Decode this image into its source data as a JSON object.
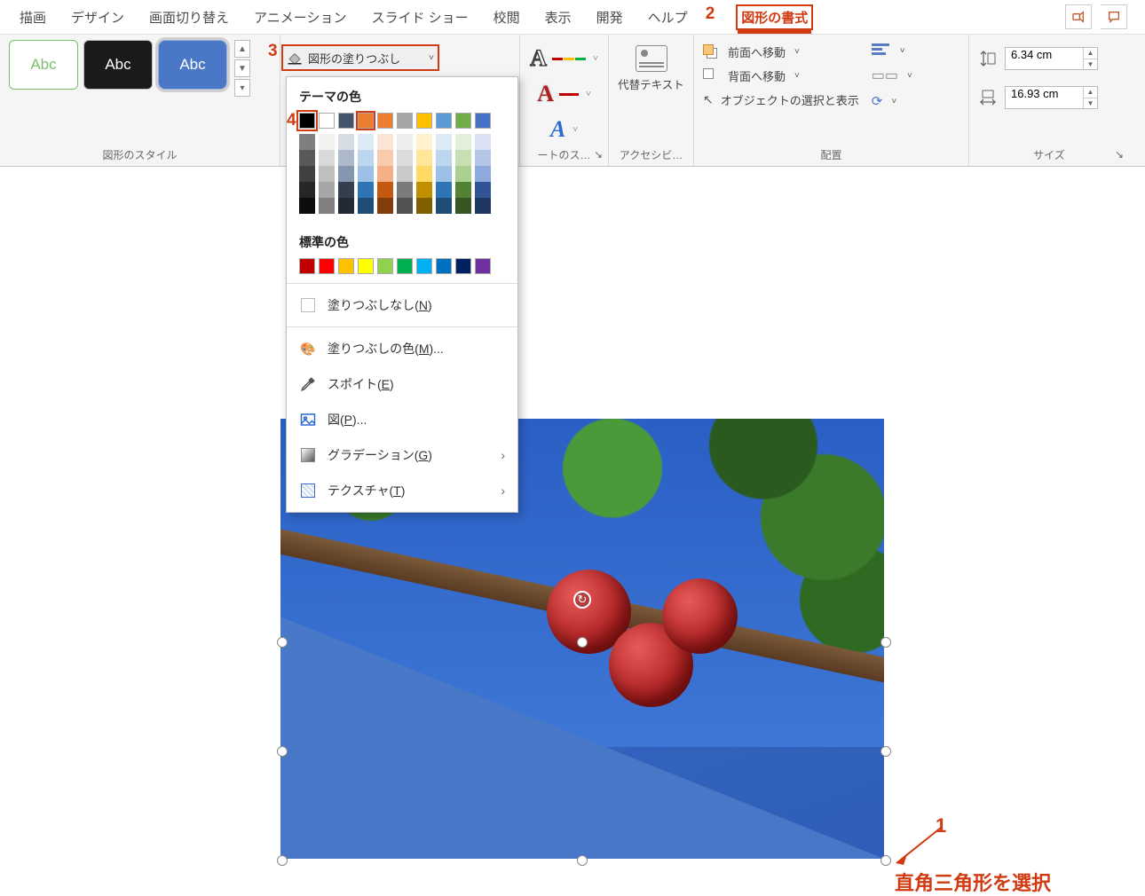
{
  "tabs": {
    "draw": "描画",
    "design": "デザイン",
    "transition": "画面切り替え",
    "animation": "アニメーション",
    "slideshow": "スライド ショー",
    "review": "校閲",
    "view": "表示",
    "developer": "開発",
    "help": "ヘルプ",
    "shape_format": "図形の書式"
  },
  "ribbon": {
    "style_group_label": "図形のスタイル",
    "abc": "Abc",
    "fill_button_label": "図形の塗りつぶし",
    "wordart_group_label": "ートのス…",
    "alt_text": "代替テキスト",
    "accessibility_label": "アクセシビ…",
    "arrange": {
      "bring_forward": "前面へ移動",
      "send_backward": "背面へ移動",
      "selection_pane": "オブジェクトの選択と表示",
      "group_label": "配置"
    },
    "size": {
      "height": "6.34 cm",
      "width": "16.93 cm",
      "group_label": "サイズ"
    }
  },
  "color_popup": {
    "theme_title": "テーマの色",
    "standard_title": "標準の色",
    "no_fill": "塗りつぶしなし",
    "no_fill_key": "N",
    "more_colors": "塗りつぶしの色",
    "more_colors_key": "M",
    "eyedropper": "スポイト",
    "eyedropper_key": "E",
    "picture": "図",
    "picture_key": "P",
    "gradient": "グラデーション",
    "gradient_key": "G",
    "texture": "テクスチャ",
    "texture_key": "T",
    "theme_row": [
      "#000000",
      "#ffffff",
      "#44546a",
      "#ed7d31",
      "#ed7d31",
      "#a5a5a5",
      "#ffc000",
      "#5b9bd5",
      "#70ad47",
      "#4472c4"
    ],
    "shade_cols": [
      [
        "#7f7f7f",
        "#595959",
        "#404040",
        "#262626",
        "#0d0d0d"
      ],
      [
        "#f2f2f2",
        "#d9d9d9",
        "#bfbfbf",
        "#a6a6a6",
        "#808080"
      ],
      [
        "#d5dce4",
        "#acb9ca",
        "#8496b0",
        "#333f4f",
        "#222b35"
      ],
      [
        "#deebf7",
        "#bdd7ee",
        "#9bc2e6",
        "#2f75b5",
        "#1f4e78"
      ],
      [
        "#fbe5d6",
        "#f8cbad",
        "#f4b084",
        "#c65911",
        "#833c0c"
      ],
      [
        "#ededed",
        "#dbdbdb",
        "#c9c9c9",
        "#7b7b7b",
        "#525252"
      ],
      [
        "#fff2cc",
        "#ffe699",
        "#ffd966",
        "#bf8f00",
        "#806000"
      ],
      [
        "#ddebf7",
        "#bdd7ee",
        "#9bc2e6",
        "#2f75b5",
        "#1f4e78"
      ],
      [
        "#e2efda",
        "#c6e0b4",
        "#a9d08e",
        "#548235",
        "#375623"
      ],
      [
        "#d9e1f2",
        "#b4c6e7",
        "#8ea9db",
        "#305496",
        "#203764"
      ]
    ],
    "standard_row": [
      "#c00000",
      "#ff0000",
      "#ffc000",
      "#ffff00",
      "#92d050",
      "#00b050",
      "#00b0f0",
      "#0070c0",
      "#002060",
      "#7030a0"
    ]
  },
  "annotations": {
    "n1": "1",
    "n2": "2",
    "n3": "3",
    "n4": "4",
    "text1": "直角三角形を選択"
  }
}
